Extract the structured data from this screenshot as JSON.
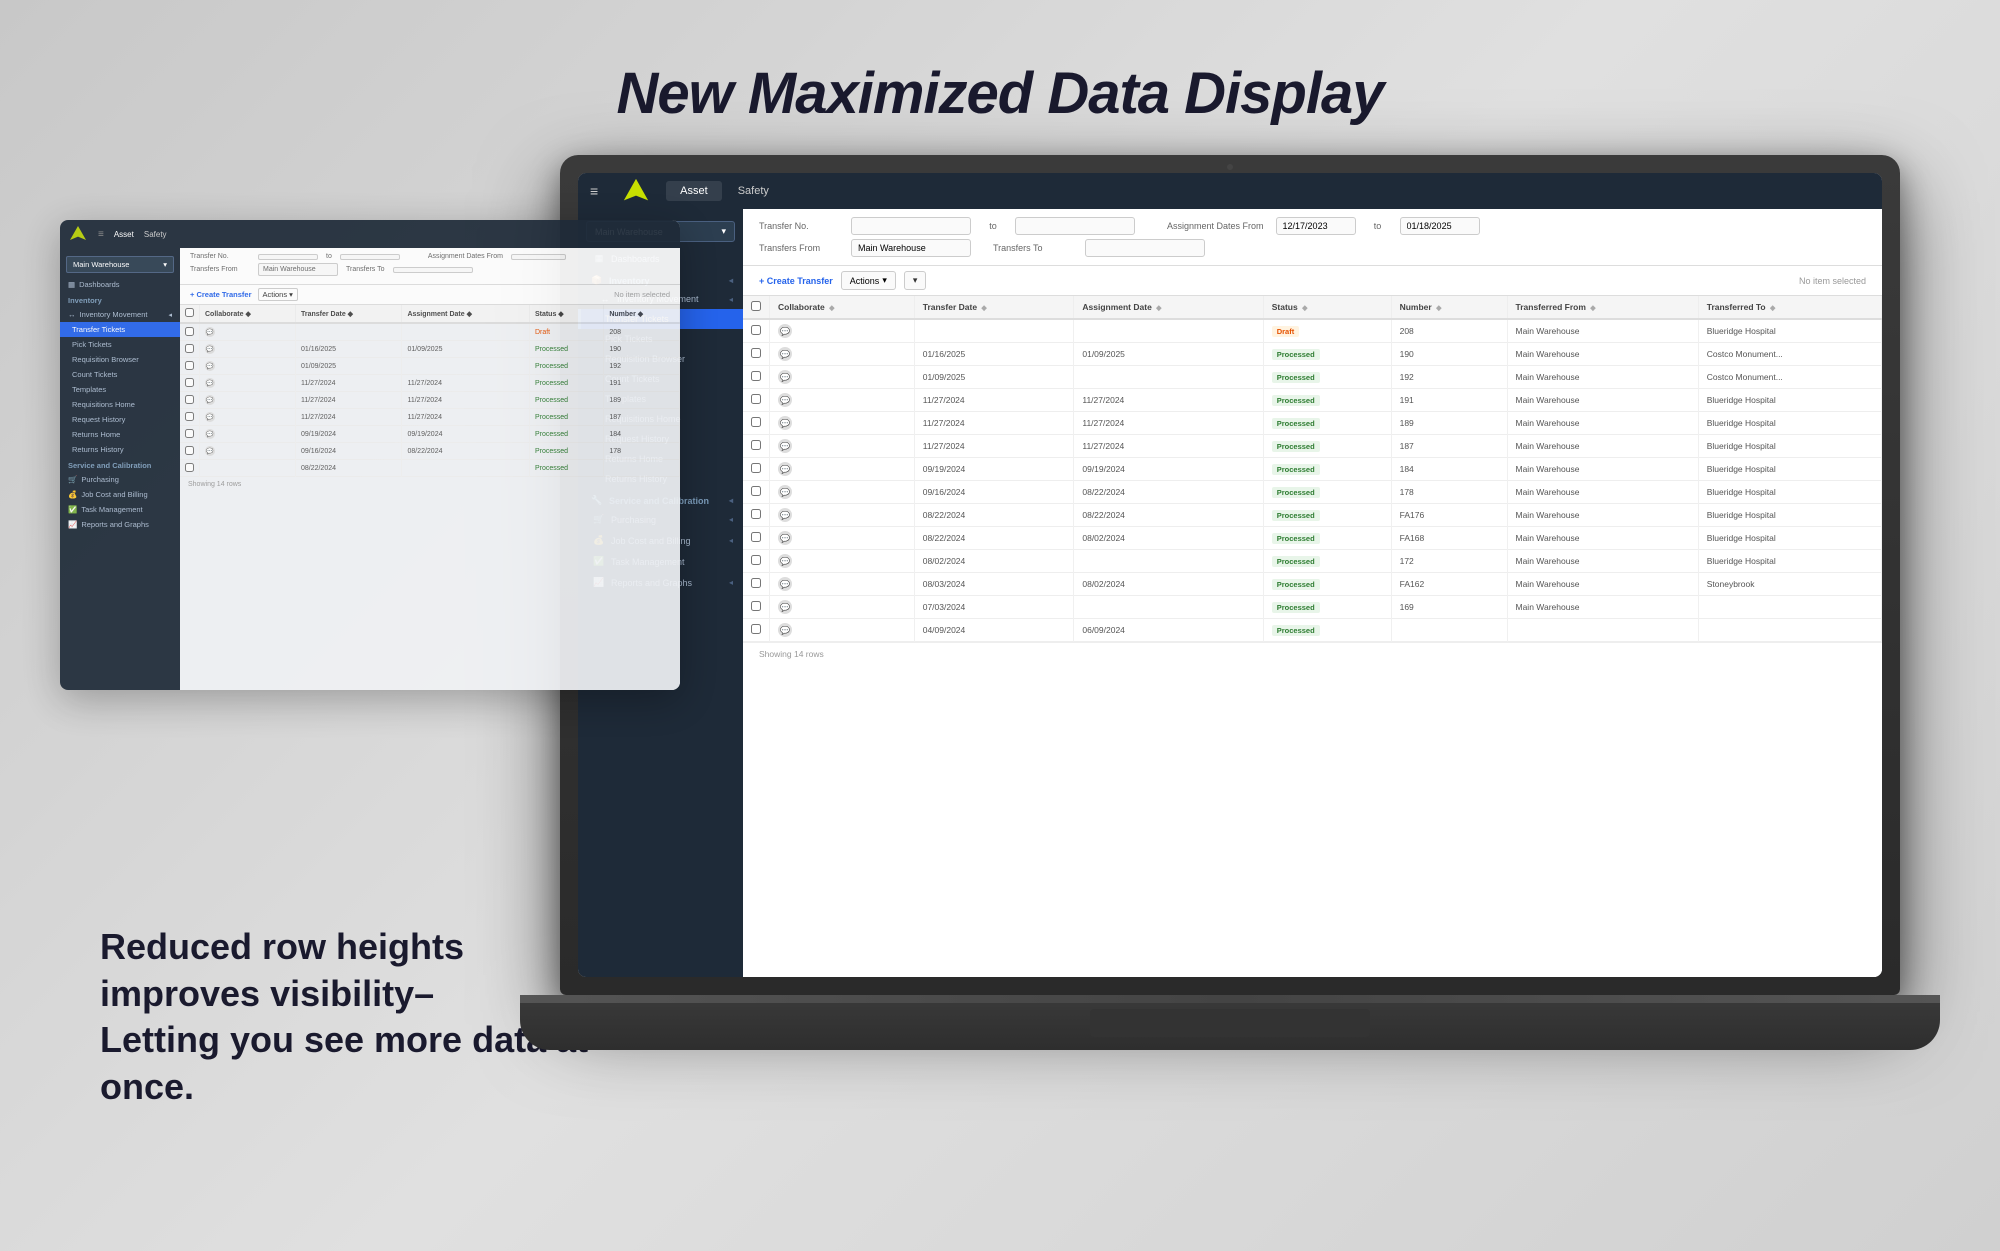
{
  "page": {
    "headline": "New Maximized Data Display",
    "bottom_text_line1": "Reduced row heights",
    "bottom_text_line2": "improves visibility–",
    "bottom_text_line3": "Letting you see more data at once."
  },
  "nav": {
    "hamburger": "≡",
    "tabs": [
      "Asset",
      "Safety"
    ],
    "active_tab": "Asset"
  },
  "sidebar": {
    "warehouse_label": "Main Warehouse",
    "items": [
      {
        "label": "Dashboards",
        "icon": "📊",
        "type": "item"
      },
      {
        "label": "Inventory",
        "icon": "📦",
        "type": "section-header"
      },
      {
        "label": "Inventory Movement",
        "icon": "↔",
        "type": "item"
      },
      {
        "label": "Transfer Tickets",
        "icon": "🎫",
        "type": "sub-item",
        "active": true
      },
      {
        "label": "Pick Tickets",
        "icon": "✓",
        "type": "sub-item"
      },
      {
        "label": "Requisition Browser",
        "icon": "🔍",
        "type": "sub-item"
      },
      {
        "label": "Count Tickets",
        "icon": "🔢",
        "type": "sub-item"
      },
      {
        "label": "Templates",
        "icon": "📋",
        "type": "sub-item"
      },
      {
        "label": "Requisitions Home",
        "icon": "🏠",
        "type": "sub-item"
      },
      {
        "label": "Request History",
        "icon": "📜",
        "type": "sub-item"
      },
      {
        "label": "Returns Home",
        "icon": "↩",
        "type": "sub-item"
      },
      {
        "label": "Returns History",
        "icon": "📜",
        "type": "sub-item"
      },
      {
        "label": "Service and Calibration",
        "icon": "🔧",
        "type": "section-header"
      },
      {
        "label": "Purchasing",
        "icon": "🛒",
        "type": "item"
      },
      {
        "label": "Job Cost and Billing",
        "icon": "💰",
        "type": "item"
      },
      {
        "label": "Task Management",
        "icon": "✅",
        "type": "item"
      },
      {
        "label": "Reports and Graphs",
        "icon": "📈",
        "type": "item"
      }
    ]
  },
  "filters": {
    "transfer_no_label": "Transfer No.",
    "to_label": "to",
    "assignment_dates_from_label": "Assignment Dates From",
    "date_from": "12/17/2023",
    "date_to": "01/18/2025",
    "transfers_from_label": "Transfers From",
    "transfers_from_value": "Main Warehouse",
    "transfers_to_label": "Transfers To"
  },
  "toolbar": {
    "create_label": "+ Create Transfer",
    "actions_label": "Actions",
    "no_item_label": "No item selected"
  },
  "table": {
    "columns": [
      {
        "key": "check",
        "label": ""
      },
      {
        "key": "collaborate",
        "label": "Collaborate ◆"
      },
      {
        "key": "transfer_date",
        "label": "Transfer Date ◆"
      },
      {
        "key": "assignment_date",
        "label": "Assignment Date ◆"
      },
      {
        "key": "status",
        "label": "Status ◆"
      },
      {
        "key": "number",
        "label": "Number ◆"
      },
      {
        "key": "transferred_from",
        "label": "Transferred From ◆"
      },
      {
        "key": "transferred_to",
        "label": "Transferred To ◆"
      }
    ],
    "rows": [
      {
        "check": false,
        "icon": true,
        "transfer_date": "",
        "assignment_date": "",
        "status": "Draft",
        "number": "208",
        "transferred_from": "Main Warehouse",
        "transferred_to": "Blueridge Hospital"
      },
      {
        "check": false,
        "icon": true,
        "transfer_date": "01/16/2025",
        "assignment_date": "01/09/2025",
        "status": "Processed",
        "number": "190",
        "transferred_from": "Main Warehouse",
        "transferred_to": "Costco Monument..."
      },
      {
        "check": false,
        "icon": true,
        "transfer_date": "01/09/2025",
        "assignment_date": "",
        "status": "Processed",
        "number": "192",
        "transferred_from": "Main Warehouse",
        "transferred_to": "Costco Monument..."
      },
      {
        "check": false,
        "icon": true,
        "transfer_date": "11/27/2024",
        "assignment_date": "11/27/2024",
        "status": "Processed",
        "number": "191",
        "transferred_from": "Main Warehouse",
        "transferred_to": "Blueridge Hospital"
      },
      {
        "check": false,
        "icon": true,
        "transfer_date": "11/27/2024",
        "assignment_date": "11/27/2024",
        "status": "Processed",
        "number": "189",
        "transferred_from": "Main Warehouse",
        "transferred_to": "Blueridge Hospital"
      },
      {
        "check": false,
        "icon": true,
        "transfer_date": "11/27/2024",
        "assignment_date": "11/27/2024",
        "status": "Processed",
        "number": "187",
        "transferred_from": "Main Warehouse",
        "transferred_to": "Blueridge Hospital"
      },
      {
        "check": false,
        "icon": true,
        "transfer_date": "09/19/2024",
        "assignment_date": "09/19/2024",
        "status": "Processed",
        "number": "184",
        "transferred_from": "Main Warehouse",
        "transferred_to": "Blueridge Hospital"
      },
      {
        "check": false,
        "icon": true,
        "transfer_date": "09/16/2024",
        "assignment_date": "08/22/2024",
        "status": "Processed",
        "number": "178",
        "transferred_from": "Main Warehouse",
        "transferred_to": "Blueridge Hospital"
      },
      {
        "check": false,
        "icon": true,
        "transfer_date": "08/22/2024",
        "assignment_date": "08/22/2024",
        "status": "Processed",
        "number": "FA176",
        "transferred_from": "Main Warehouse",
        "transferred_to": "Blueridge Hospital"
      },
      {
        "check": false,
        "icon": true,
        "transfer_date": "08/22/2024",
        "assignment_date": "08/02/2024",
        "status": "Processed",
        "number": "FA168",
        "transferred_from": "Main Warehouse",
        "transferred_to": "Blueridge Hospital"
      },
      {
        "check": false,
        "icon": true,
        "transfer_date": "08/02/2024",
        "assignment_date": "",
        "status": "Processed",
        "number": "172",
        "transferred_from": "Main Warehouse",
        "transferred_to": "Blueridge Hospital"
      },
      {
        "check": false,
        "icon": true,
        "transfer_date": "08/03/2024",
        "assignment_date": "08/02/2024",
        "status": "Processed",
        "number": "FA162",
        "transferred_from": "Main Warehouse",
        "transferred_to": "Stoneybrook"
      },
      {
        "check": false,
        "icon": true,
        "transfer_date": "07/03/2024",
        "assignment_date": "",
        "status": "Processed",
        "number": "169",
        "transferred_from": "Main Warehouse",
        "transferred_to": ""
      },
      {
        "check": false,
        "icon": true,
        "transfer_date": "04/09/2024",
        "assignment_date": "06/09/2024",
        "status": "Processed",
        "number": "",
        "transferred_from": "",
        "transferred_to": ""
      }
    ],
    "footer": "Showing 14 rows"
  }
}
